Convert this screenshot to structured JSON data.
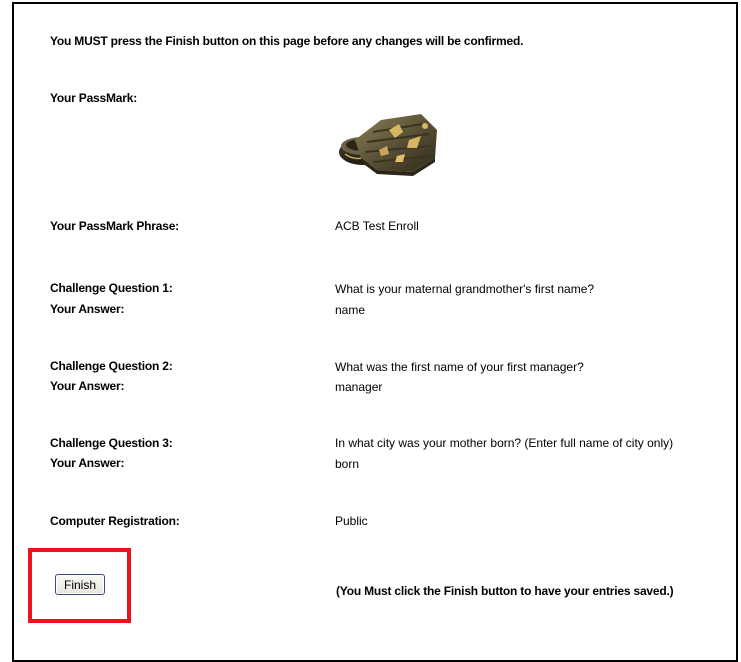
{
  "notice": "You MUST press the Finish button on this page before any changes will be confirmed.",
  "passmark": {
    "label": "Your PassMark:",
    "image": "passmark-box-image"
  },
  "phrase": {
    "label": "Your PassMark Phrase:",
    "value": "ACB Test Enroll"
  },
  "challenges": [
    {
      "question_label": "Challenge Question 1:",
      "answer_label": "Your Answer:",
      "question": "What is your maternal grandmother's first name?",
      "answer": "name"
    },
    {
      "question_label": "Challenge Question 2:",
      "answer_label": "Your Answer:",
      "question": "What was the first name of your first manager?",
      "answer": "manager"
    },
    {
      "question_label": "Challenge Question 3:",
      "answer_label": "Your Answer:",
      "question": "In what city was your mother born? (Enter full name of city only)",
      "answer": "born"
    }
  ],
  "computer_registration": {
    "label": "Computer Registration:",
    "value": "Public"
  },
  "finish": {
    "button_label": "Finish",
    "note": "(You Must click the Finish button to have your entries saved.)"
  },
  "colors": {
    "highlight": "#e8141a",
    "border": "#000000"
  }
}
